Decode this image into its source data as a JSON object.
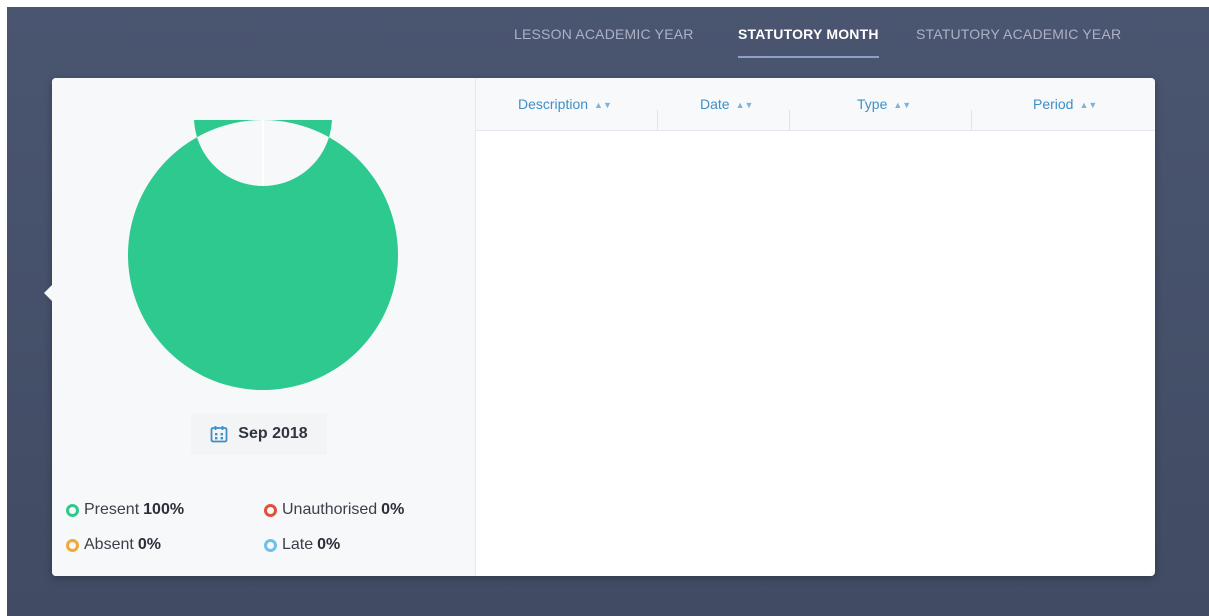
{
  "tabs": [
    {
      "label": "LESSON ACADEMIC YEAR",
      "active": false
    },
    {
      "label": "STATUTORY MONTH",
      "active": true
    },
    {
      "label": "STATUTORY ACADEMIC YEAR",
      "active": false
    }
  ],
  "summary": {
    "month": "Sep 2018",
    "calendar_icon": "calendar-icon",
    "chart_colors": {
      "present": "#2ec98f",
      "gap": "#ffffff"
    },
    "legend": [
      {
        "label": "Present",
        "value": "100%",
        "color": "#2ec98f"
      },
      {
        "label": "Unauthorised",
        "value": "0%",
        "color": "#e0503a"
      },
      {
        "label": "Absent",
        "value": "0%",
        "color": "#f0a83a"
      },
      {
        "label": "Late",
        "value": "0%",
        "color": "#6ec1ec"
      }
    ]
  },
  "chart_data": {
    "type": "pie",
    "labels": [
      "Present",
      "Unauthorised",
      "Absent",
      "Late"
    ],
    "values": [
      100,
      0,
      0,
      0
    ],
    "unit": "%"
  },
  "table": {
    "columns": [
      "Description",
      "Date",
      "Type",
      "Period"
    ],
    "sort_icon": "sort-icon",
    "rows": []
  }
}
